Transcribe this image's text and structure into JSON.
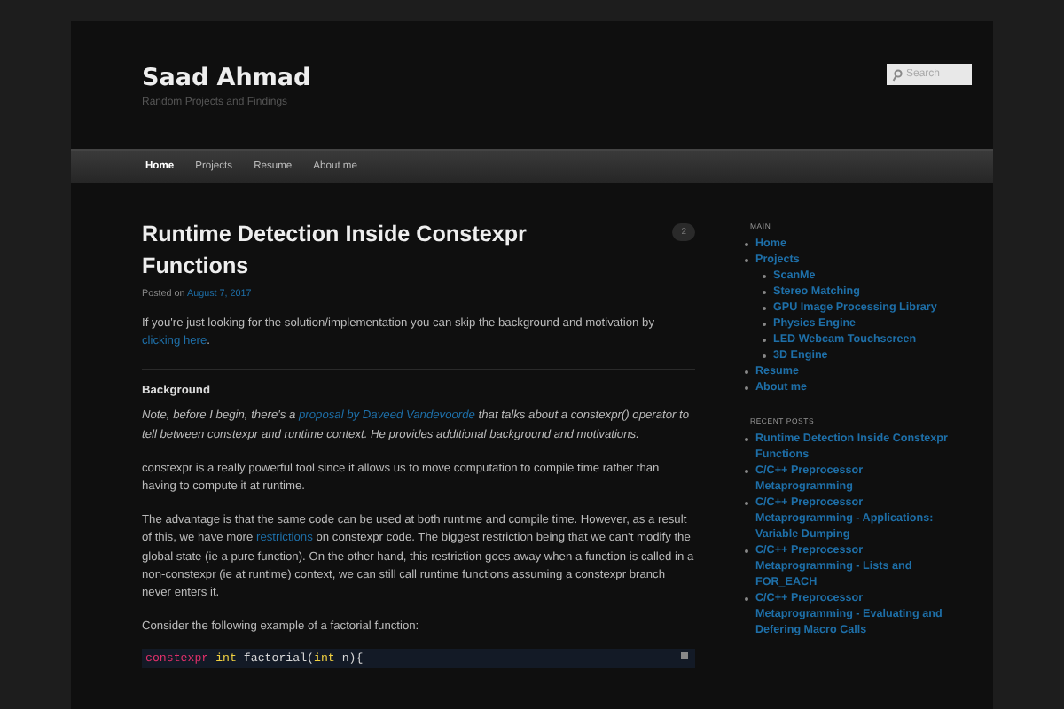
{
  "site": {
    "title": "Saad Ahmad",
    "tagline": "Random Projects and Findings"
  },
  "search": {
    "placeholder": "Search"
  },
  "nav": [
    {
      "label": "Home",
      "selected": true
    },
    {
      "label": "Projects",
      "selected": false
    },
    {
      "label": "Resume",
      "selected": false
    },
    {
      "label": "About me",
      "selected": false
    }
  ],
  "post": {
    "title": "Runtime Detection Inside Constexpr Functions",
    "comments": "2",
    "posted_label": "Posted on",
    "date": "August 7, 2017",
    "blocks": [
      {
        "kind": "para",
        "parts": [
          {
            "text": "If you're just looking for the solution/implementation you can skip the background and motivation by ",
            "link": false
          },
          {
            "text": "clicking here",
            "link": true
          },
          {
            "text": ".",
            "link": false
          }
        ]
      },
      {
        "kind": "rule"
      },
      {
        "kind": "heading",
        "text": "Background"
      },
      {
        "kind": "note",
        "parts": [
          {
            "text": "Note, before I begin, there's a ",
            "link": false
          },
          {
            "text": "proposal by Daveed Vandevoorde",
            "link": true
          },
          {
            "text": " that talks about a constexpr() operator to tell between constexpr and runtime context. He provides additional background and motivations.",
            "link": false
          }
        ]
      },
      {
        "kind": "para",
        "parts": [
          {
            "text": "constexpr is a really powerful tool since it allows us to move computation to compile time rather than having to compute it at runtime.",
            "link": false
          }
        ]
      },
      {
        "kind": "para",
        "parts": [
          {
            "text": "The advantage is that the same code can be used at both runtime and compile time. However, as a result of this, we have more ",
            "link": false
          },
          {
            "text": "restrictions",
            "link": true
          },
          {
            "text": " on constexpr code. The biggest restriction being that we can't modify the global state (ie a pure function). On the other hand, this restriction goes away when a function is called in a non-constexpr (ie at runtime) context, we can still call runtime functions assuming a constexpr branch never enters it.",
            "link": false
          }
        ]
      },
      {
        "kind": "para",
        "parts": [
          {
            "text": "Consider the following example of a factorial function:",
            "link": false
          }
        ]
      },
      {
        "kind": "code",
        "tokens": [
          {
            "text": "constexpr",
            "kind": "keyword"
          },
          {
            "text": " int",
            "kind": "type"
          },
          {
            "text": " factorial(",
            "kind": "plain"
          },
          {
            "text": "int",
            "kind": "type"
          },
          {
            "text": " n){",
            "kind": "plain"
          }
        ]
      }
    ]
  },
  "sidebar": [
    {
      "heading": "MAIN",
      "items": [
        {
          "label": "Home"
        },
        {
          "label": "Projects",
          "children": [
            {
              "label": "ScanMe"
            },
            {
              "label": "Stereo Matching"
            },
            {
              "label": "GPU Image Processing Library"
            },
            {
              "label": "Physics Engine"
            },
            {
              "label": "LED Webcam Touchscreen"
            },
            {
              "label": "3D Engine"
            }
          ]
        },
        {
          "label": "Resume"
        },
        {
          "label": "About me"
        }
      ]
    },
    {
      "heading": "RECENT POSTS",
      "items": [
        {
          "label": "Runtime Detection Inside Constexpr Functions"
        },
        {
          "label": "C/C++ Preprocessor Metaprogramming"
        },
        {
          "label": "C/C++ Preprocessor Metaprogramming - Applications: Variable Dumping"
        },
        {
          "label": "C/C++ Preprocessor Metaprogramming - Lists and FOR_EACH"
        },
        {
          "label": "C/C++ Preprocessor Metaprogramming - Evaluating and Defering Macro Calls"
        }
      ]
    }
  ]
}
